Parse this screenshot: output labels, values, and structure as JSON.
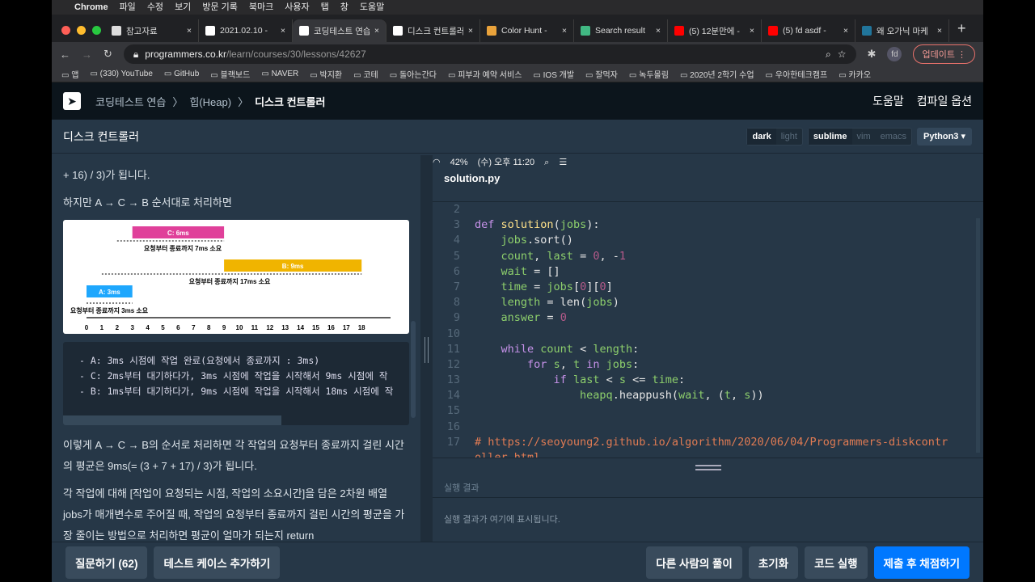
{
  "menubar": {
    "app": "Chrome",
    "items": [
      "파일",
      "수정",
      "보기",
      "방문 기록",
      "북마크",
      "사용자",
      "탭",
      "창",
      "도움말"
    ],
    "battery": "42%",
    "clock": "(수) 오후 11:20"
  },
  "tabs": [
    {
      "label": "참고자료",
      "icon": "doc-icon",
      "color": "#ddd"
    },
    {
      "label": "2021.02.10 -",
      "icon": "notion-icon",
      "color": "#fff"
    },
    {
      "label": "코딩테스트 연습",
      "icon": "programmers-icon",
      "color": "#fff",
      "active": true
    },
    {
      "label": "디스크 컨트롤러",
      "icon": "notion-icon",
      "color": "#fff"
    },
    {
      "label": "Color Hunt -",
      "icon": "colorhunt-icon",
      "color": "#e9a23b"
    },
    {
      "label": "Search result",
      "icon": "vue-icon",
      "color": "#41b883"
    },
    {
      "label": "(5) 12분만에 -",
      "icon": "youtube-icon",
      "color": "#f00"
    },
    {
      "label": "(5) fd asdf -",
      "icon": "youtube-icon",
      "color": "#f00"
    },
    {
      "label": "왜 오가닉 마케",
      "icon": "wordpress-icon",
      "color": "#21759b"
    }
  ],
  "address": {
    "host": "programmers.co.kr",
    "path": "/learn/courses/30/lessons/42627",
    "profile": "fd",
    "update": "업데이트"
  },
  "bookmarks": [
    "앱",
    "(330) YouTube",
    "GitHub",
    "블랙보드",
    "NAVER",
    "박지환",
    "코테",
    "돌아는간다",
    "피부과 예약 서비스",
    "IOS 개발",
    "잘먹자",
    "녹두몰림",
    "2020년 2학기 수업",
    "우아한테크캠프",
    "카카오"
  ],
  "site": {
    "breadcrumb": [
      "코딩테스트 연습",
      "힙(Heap)",
      "디스크 컨트롤러"
    ],
    "help": "도움말",
    "compile_options": "컴파일 옵션"
  },
  "title": "디스크 컨트롤러",
  "toggles": {
    "theme": [
      "dark",
      "light"
    ],
    "keymap": [
      "sublime",
      "vim",
      "emacs"
    ],
    "language": "Python3"
  },
  "problem": {
    "p0": "+ 16) / 3)가 됩니다.",
    "p1": "하지만 A → C → B 순서대로 처리하면",
    "diagram": {
      "c": "C: 6ms",
      "c_note": "요청부터 종료까지 7ms 소요",
      "b": "B: 9ms",
      "b_note": "요청부터 종료까지 17ms 소요",
      "a": "A: 3ms",
      "a_note": "요청부터 종료까지 3ms 소요",
      "ticks": [
        "0",
        "1",
        "2",
        "3",
        "4",
        "5",
        "6",
        "7",
        "8",
        "9",
        "10",
        "11",
        "12",
        "13",
        "14",
        "15",
        "16",
        "17",
        "18"
      ],
      "colors": {
        "a": "#1ea7fd",
        "b": "#f0b400",
        "c": "#e0409a"
      }
    },
    "code_lines": [
      "- A: 3ms 시점에 작업 완료(요청에서 종료까지 : 3ms)",
      "- C: 2ms부터 대기하다가, 3ms 시점에 작업을 시작해서 9ms 시점에 작",
      "- B: 1ms부터 대기하다가, 9ms 시점에 작업을 시작해서 18ms 시점에 작"
    ],
    "p2": "이렇게 A → C → B의 순서로 처리하면 각 작업의 요청부터 종료까지 걸린 시간의 평균은 9ms(= (3 + 7 + 17) / 3)가 됩니다.",
    "p3": "각 작업에 대해 [작업이 요청되는 시점, 작업의 소요시간]을 담은 2차원 배열 jobs가 매개변수로 주어질 때, 작업의 요청부터 종료까지 걸린 시간의 평균을 가장 줄이는 방법으로 처리하면 평균이 얼마가 되는지 return"
  },
  "editor": {
    "filename": "solution.py",
    "lines": [
      {
        "n": "3",
        "html": "<span class=kw>def</span> <span class=fn>solution</span><span class=p>(</span><span class=v>jobs</span><span class=p>):</span>"
      },
      {
        "n": "4",
        "html": "    <span class=v>jobs</span><span class=p>.sort()</span>"
      },
      {
        "n": "5",
        "html": "    <span class=v>count</span><span class=p>, </span><span class=v>last</span><span class=p> = </span><span class=num>0</span><span class=p>, -</span><span class=num>1</span>"
      },
      {
        "n": "6",
        "html": "    <span class=v>wait</span><span class=p> = []</span>"
      },
      {
        "n": "7",
        "html": "    <span class=v>time</span><span class=p> = </span><span class=v>jobs</span><span class=p>[</span><span class=num>0</span><span class=p>][</span><span class=num>0</span><span class=p>]</span>"
      },
      {
        "n": "8",
        "html": "    <span class=v>length</span><span class=p> = len(</span><span class=v>jobs</span><span class=p>)</span>"
      },
      {
        "n": "9",
        "html": "    <span class=v>answer</span><span class=p> = </span><span class=num>0</span>"
      },
      {
        "n": "10",
        "html": ""
      },
      {
        "n": "11",
        "html": "    <span class=kw>while</span> <span class=v>count</span><span class=p> &lt; </span><span class=v>length</span><span class=p>:</span>"
      },
      {
        "n": "12",
        "html": "        <span class=kw>for</span> <span class=v>s</span><span class=p>, </span><span class=v>t</span> <span class=kw>in</span> <span class=v>jobs</span><span class=p>:</span>"
      },
      {
        "n": "13",
        "html": "            <span class=kw>if</span> <span class=v>last</span><span class=p> &lt; </span><span class=v>s</span><span class=p> &lt;= </span><span class=v>time</span><span class=p>:</span>"
      },
      {
        "n": "14",
        "html": "                <span class=v>heapq</span><span class=p>.heappush(</span><span class=v>wait</span><span class=p>, (</span><span class=v>t</span><span class=p>, </span><span class=v>s</span><span class=p>))</span>"
      },
      {
        "n": "15",
        "html": ""
      },
      {
        "n": "16",
        "html": ""
      },
      {
        "n": "17",
        "html": "<span class=cm># https://seoyoung2.github.io/algorithm/2020/06/04/Programmers-diskcontr</span>"
      },
      {
        "n": "",
        "html": "<span class=cm>oller.html</span>"
      }
    ]
  },
  "result": {
    "header": "실행 결과",
    "placeholder": "실행 결과가 여기에 표시됩니다."
  },
  "buttons": {
    "question": "질문하기 (62)",
    "add_test": "테스트 케이스 추가하기",
    "others": "다른 사람의 풀이",
    "reset": "초기화",
    "run": "코드 실행",
    "submit": "제출 후 채점하기"
  }
}
